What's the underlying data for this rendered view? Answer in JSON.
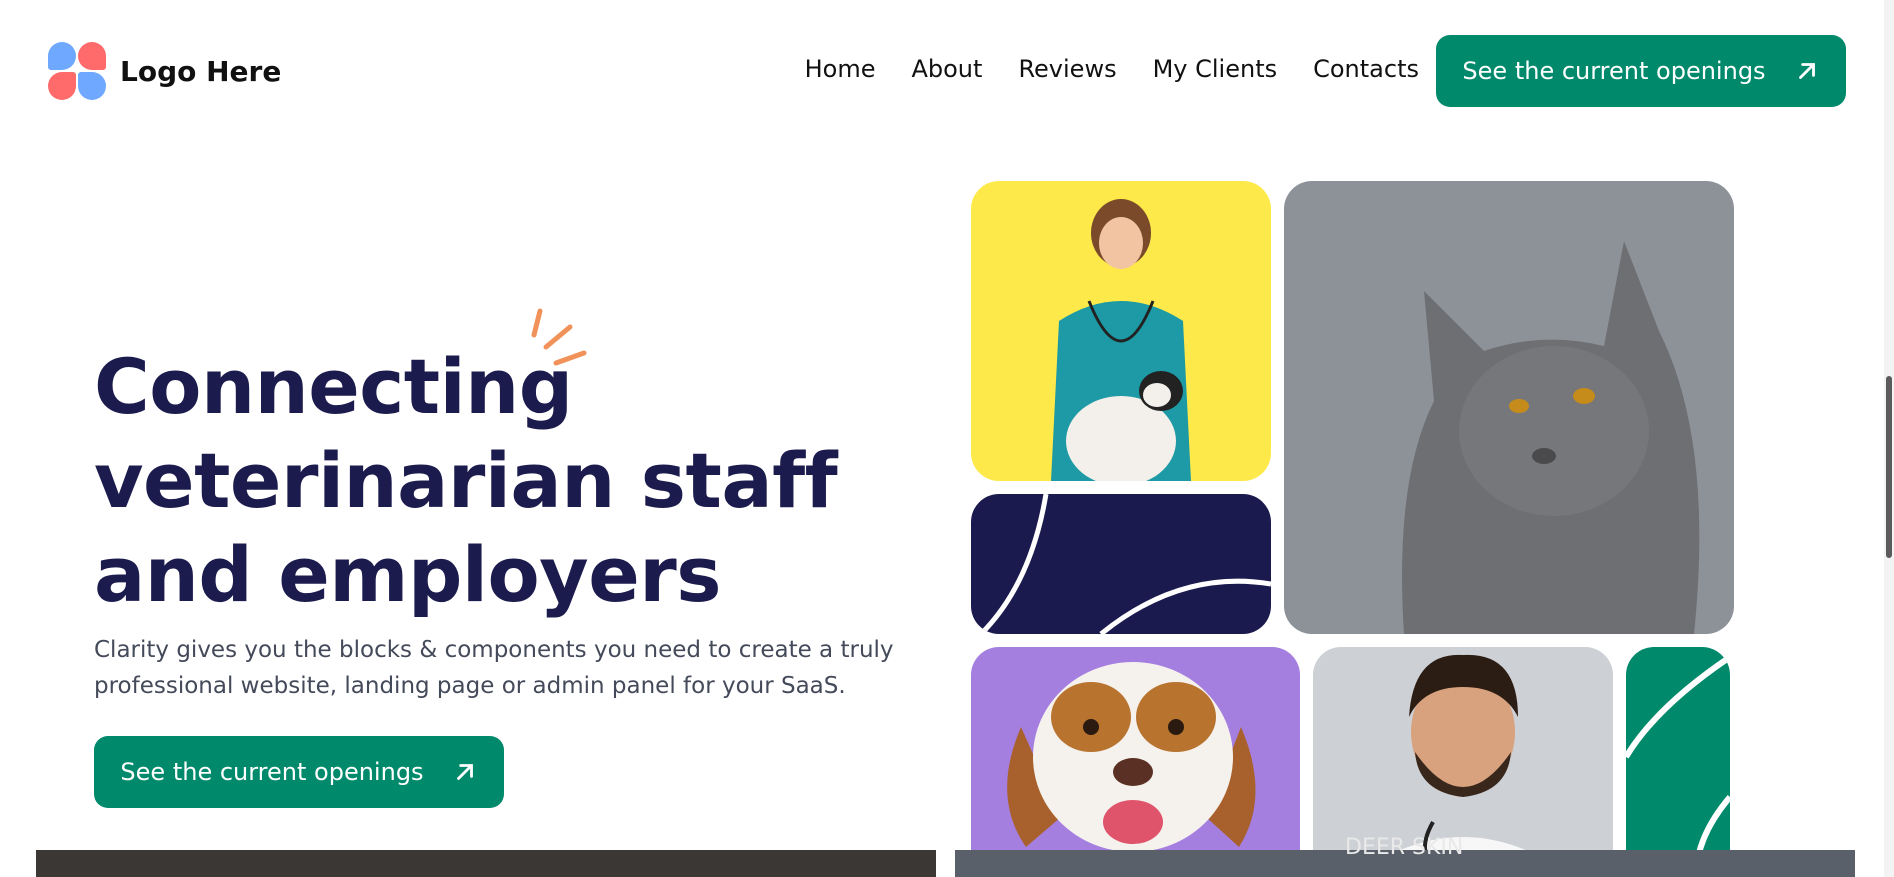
{
  "brand": {
    "logo_text": "Logo Here"
  },
  "nav": {
    "items": [
      "Home",
      "About",
      "Reviews",
      "My Clients",
      "Contacts"
    ]
  },
  "header_cta": {
    "label": "See the current openings",
    "icon": "arrow-up-right-icon"
  },
  "hero": {
    "title_lines": [
      "Connecting",
      "veterinarian staff",
      "and employers"
    ],
    "description_line1": "Clarity gives you the blocks & components you need to create a truly",
    "description_line2": "professional website, landing page or admin panel for your SaaS.",
    "cta": {
      "label": "See the current openings",
      "icon": "arrow-up-right-icon"
    }
  },
  "gallery": {
    "tiles": [
      {
        "name": "vet-with-dog-photo",
        "color": "#fde94a"
      },
      {
        "name": "grey-cat-photo",
        "color": "#8d9299"
      },
      {
        "name": "navy-decor-tile",
        "color": "#1b1a4e"
      },
      {
        "name": "beagle-photo",
        "color": "#a57fdf"
      },
      {
        "name": "doctor-portrait-photo",
        "color": "#cdd0d5"
      },
      {
        "name": "green-decor-tile",
        "color": "#008a6b"
      }
    ],
    "strip_label": "DEER SKIN"
  },
  "colors": {
    "accent": "#008a6b",
    "heading": "#1c1b4d",
    "sparkle": "#f0925a"
  }
}
